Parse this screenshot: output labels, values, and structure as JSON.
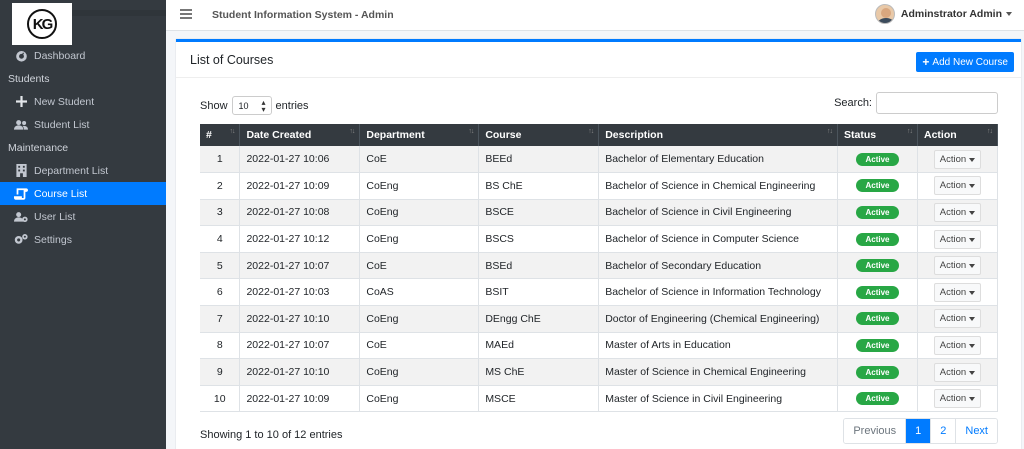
{
  "header": {
    "app_title": "Student Information System - Admin",
    "user_name": "Adminstrator Admin"
  },
  "sidebar": {
    "items": [
      {
        "label": "Dashboard",
        "icon": "dashboard-icon"
      },
      {
        "section": "Students"
      },
      {
        "label": "New Student",
        "icon": "plus-icon"
      },
      {
        "label": "Student List",
        "icon": "users-icon"
      },
      {
        "section": "Maintenance"
      },
      {
        "label": "Department List",
        "icon": "building-icon"
      },
      {
        "label": "Course List",
        "icon": "scroll-icon",
        "active": true
      },
      {
        "label": "User List",
        "icon": "users-cog-icon"
      },
      {
        "label": "Settings",
        "icon": "cogs-icon"
      }
    ]
  },
  "card": {
    "title": "List of Courses",
    "add_button": "Add New Course"
  },
  "controls": {
    "show_label": "Show",
    "entries_value": "10",
    "entries_label": "entries",
    "search_label": "Search:"
  },
  "table": {
    "columns": [
      "#",
      "Date Created",
      "Department",
      "Course",
      "Description",
      "Status",
      "Action"
    ],
    "rows": [
      {
        "n": "1",
        "date": "2022-01-27 10:06",
        "dept": "CoE",
        "course": "BEEd",
        "desc": "Bachelor of Elementary Education",
        "status": "Active",
        "action": "Action"
      },
      {
        "n": "2",
        "date": "2022-01-27 10:09",
        "dept": "CoEng",
        "course": "BS ChE",
        "desc": "Bachelor of Science in Chemical Engineering",
        "status": "Active",
        "action": "Action"
      },
      {
        "n": "3",
        "date": "2022-01-27 10:08",
        "dept": "CoEng",
        "course": "BSCE",
        "desc": "Bachelor of Science in Civil Engineering",
        "status": "Active",
        "action": "Action"
      },
      {
        "n": "4",
        "date": "2022-01-27 10:12",
        "dept": "CoEng",
        "course": "BSCS",
        "desc": "Bachelor of Science in Computer Science",
        "status": "Active",
        "action": "Action"
      },
      {
        "n": "5",
        "date": "2022-01-27 10:07",
        "dept": "CoE",
        "course": "BSEd",
        "desc": "Bachelor of Secondary Education",
        "status": "Active",
        "action": "Action"
      },
      {
        "n": "6",
        "date": "2022-01-27 10:03",
        "dept": "CoAS",
        "course": "BSIT",
        "desc": "Bachelor of Science in Information Technology",
        "status": "Active",
        "action": "Action"
      },
      {
        "n": "7",
        "date": "2022-01-27 10:10",
        "dept": "CoEng",
        "course": "DEngg ChE",
        "desc": "Doctor of Engineering (Chemical Engineering)",
        "status": "Active",
        "action": "Action"
      },
      {
        "n": "8",
        "date": "2022-01-27 10:07",
        "dept": "CoE",
        "course": "MAEd",
        "desc": "Master of Arts in Education",
        "status": "Active",
        "action": "Action"
      },
      {
        "n": "9",
        "date": "2022-01-27 10:10",
        "dept": "CoEng",
        "course": "MS ChE",
        "desc": "Master of Science in Chemical Engineering",
        "status": "Active",
        "action": "Action"
      },
      {
        "n": "10",
        "date": "2022-01-27 10:09",
        "dept": "CoEng",
        "course": "MSCE",
        "desc": "Master of Science in Civil Engineering",
        "status": "Active",
        "action": "Action"
      }
    ]
  },
  "footer": {
    "info": "Showing 1 to 10 of 12 entries",
    "pagination": [
      "Previous",
      "1",
      "2",
      "Next"
    ]
  },
  "colors": {
    "sidebar_bg": "#343a40",
    "accent": "#007bff",
    "status_active": "#28a745"
  }
}
